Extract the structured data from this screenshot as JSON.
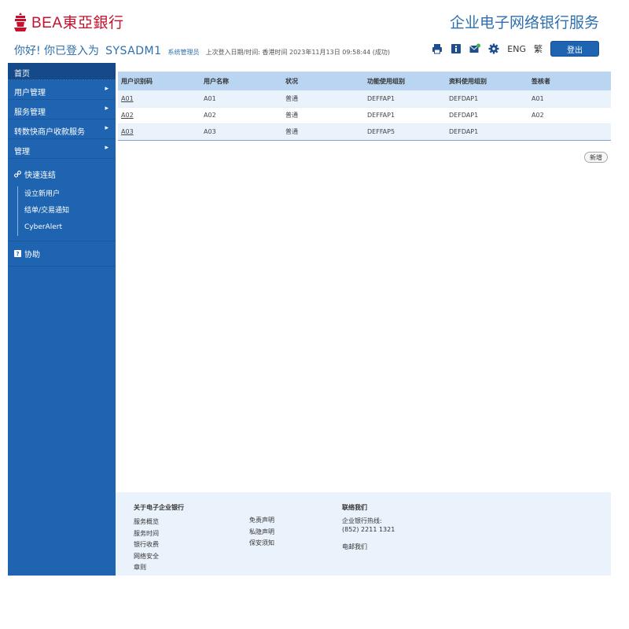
{
  "header": {
    "logo_text": "BEA東亞銀行",
    "site_title": "企业电子网络银行服务",
    "greeting": "你好! 你已登入为",
    "username": "SYSADM1",
    "role": "系统管理员",
    "last_login": "上次登入日期/时间: 香港时间 2023年11月13日 09:58:44 (成功)",
    "lang_eng": "ENG",
    "lang_trad": "繁",
    "logout": "登出"
  },
  "sidebar": {
    "home": "首页",
    "items": [
      {
        "label": "用户管理"
      },
      {
        "label": "服务管理"
      },
      {
        "label": "转数快商户收款服务"
      },
      {
        "label": "管理"
      }
    ],
    "quick_title": "快速连结",
    "quick_links": [
      "设立新用户",
      "结单/交易通知",
      "CyberAlert"
    ],
    "help": "协助"
  },
  "table": {
    "headers": [
      "用户识别码",
      "用户名称",
      "状况",
      "功能使用组别",
      "资料使用组别",
      "签核者"
    ],
    "rows": [
      [
        "A01",
        "A01",
        "普通",
        "DEFFAP1",
        "DEFDAP1",
        "A01"
      ],
      [
        "A02",
        "A02",
        "普通",
        "DEFFAP1",
        "DEFDAP1",
        "A02"
      ],
      [
        "A03",
        "A03",
        "普通",
        "DEFFAP5",
        "DEFDAP1",
        ""
      ]
    ],
    "add_button": "新增"
  },
  "footer": {
    "about_title": "关于电子企业银行",
    "about_links": [
      "服务概览",
      "服务时间",
      "银行收费",
      "网络安全",
      "章则"
    ],
    "legal_links": [
      "免责声明",
      "私隐声明",
      "保安须知"
    ],
    "contact_title": "联络我们",
    "hotline_label": "企业银行热线:",
    "hotline_number": "(852) 2211 1321",
    "email_us": "电邮我们"
  },
  "colors": {
    "brand_red": "#c8102e",
    "brand_blue": "#1e64b0",
    "header_row": "#b9d5f2"
  }
}
